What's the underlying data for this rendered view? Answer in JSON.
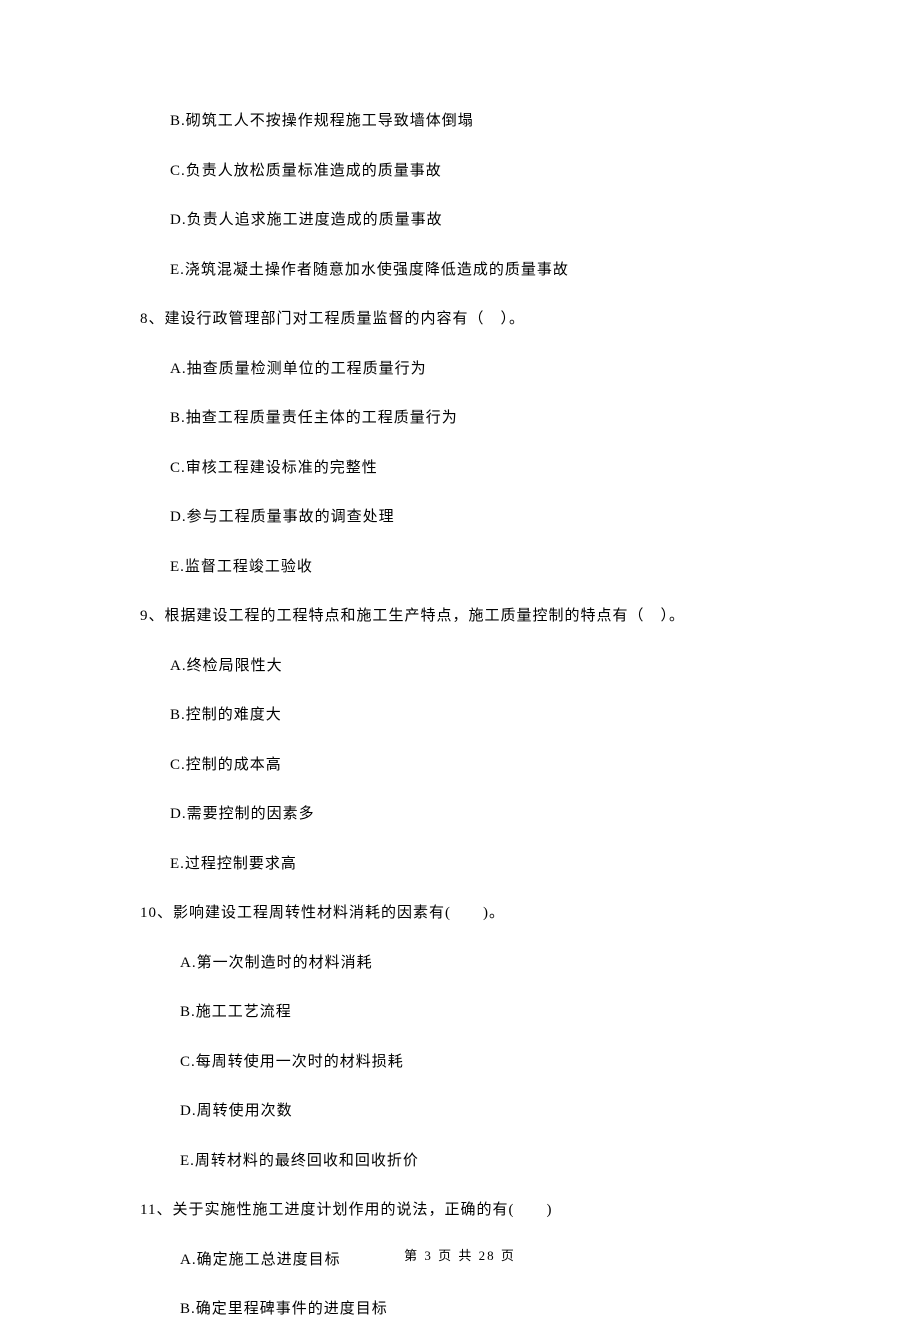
{
  "block1": {
    "optB": "B.砌筑工人不按操作规程施工导致墙体倒塌",
    "optC": "C.负责人放松质量标准造成的质量事故",
    "optD": "D.负责人追求施工进度造成的质量事故",
    "optE": "E.浇筑混凝土操作者随意加水使强度降低造成的质量事故"
  },
  "q8": {
    "stem": "8、建设行政管理部门对工程质量监督的内容有（　）。",
    "optA": "A.抽查质量检测单位的工程质量行为",
    "optB": "B.抽查工程质量责任主体的工程质量行为",
    "optC": "C.审核工程建设标准的完整性",
    "optD": "D.参与工程质量事故的调查处理",
    "optE": "E.监督工程竣工验收"
  },
  "q9": {
    "stem": "9、根据建设工程的工程特点和施工生产特点，施工质量控制的特点有（　）。",
    "optA": "A.终检局限性大",
    "optB": "B.控制的难度大",
    "optC": "C.控制的成本高",
    "optD": "D.需要控制的因素多",
    "optE": "E.过程控制要求高"
  },
  "q10": {
    "stem": "10、影响建设工程周转性材料消耗的因素有(　　)。",
    "optA": "A.第一次制造时的材料消耗",
    "optB": "B.施工工艺流程",
    "optC": "C.每周转使用一次时的材料损耗",
    "optD": "D.周转使用次数",
    "optE": "E.周转材料的最终回收和回收折价"
  },
  "q11": {
    "stem": "11、关于实施性施工进度计划作用的说法，正确的有(　　)",
    "optA": "A.确定施工总进度目标",
    "optB": "B.确定里程碑事件的进度目标"
  },
  "footer": "第 3 页 共 28 页"
}
